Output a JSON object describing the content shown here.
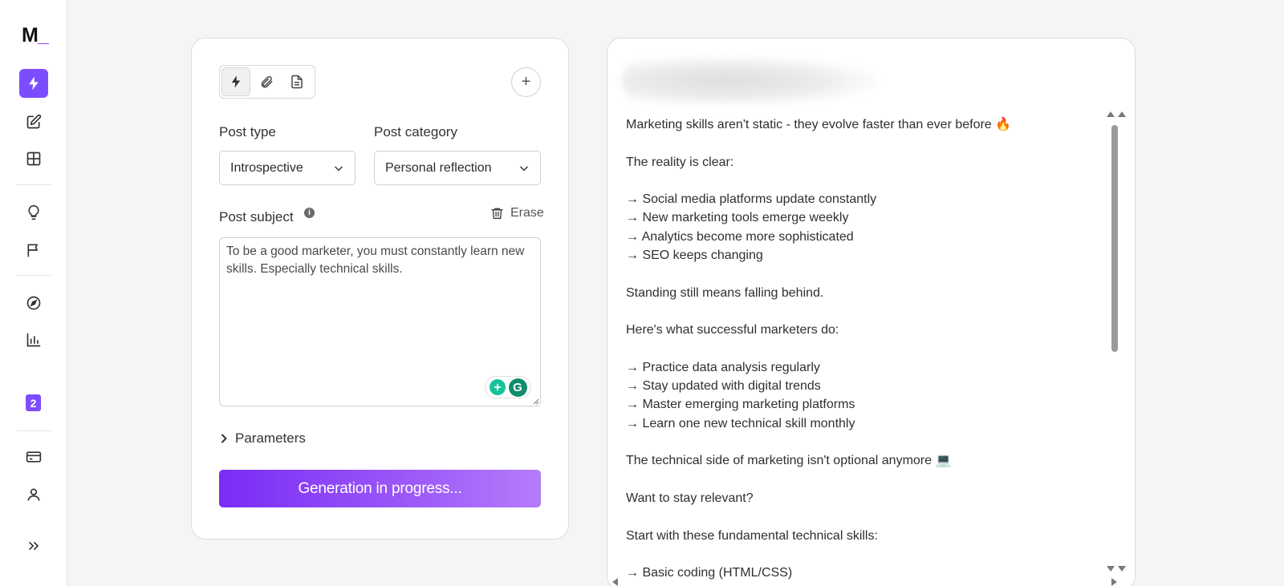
{
  "logo": {
    "text": "M",
    "accent": "_"
  },
  "colors": {
    "accent": "#7c4dff",
    "button_start": "#7a2cf5",
    "button_end": "#b47cfb"
  },
  "sidebar": {
    "icons": [
      "bolt-icon",
      "edit-icon",
      "grid-icon",
      "lightbulb-icon",
      "flag-icon",
      "compass-icon",
      "bar-chart-icon",
      "credit-card-icon",
      "user-icon",
      "double-chevron-right-icon"
    ],
    "badge": "2"
  },
  "form": {
    "modes": [
      "bolt-icon",
      "paperclip-icon",
      "document-icon"
    ],
    "add_label": "+",
    "post_type": {
      "label": "Post type",
      "value": "Introspective"
    },
    "post_category": {
      "label": "Post category",
      "value": "Personal reflection"
    },
    "post_subject": {
      "label": "Post subject",
      "info": "i",
      "erase_label": "Erase",
      "value": "To be a good marketer, you must constantly learn new skills. Especially technical skills."
    },
    "parameters_label": "Parameters",
    "generate_label": "Generation in progress..."
  },
  "result": {
    "lines": [
      "Marketing skills aren't static - they evolve faster than ever before 🔥",
      "",
      "The reality is clear:",
      "",
      "→ Social media platforms update constantly",
      "→ New marketing tools emerge weekly",
      "→ Analytics become more sophisticated",
      "→ SEO keeps changing",
      "",
      "Standing still means falling behind.",
      "",
      "Here's what successful marketers do:",
      "",
      "→ Practice data analysis regularly",
      "→ Stay updated with digital trends",
      "→ Master emerging marketing platforms",
      "→ Learn one new technical skill monthly",
      "",
      "The technical side of marketing isn't optional anymore 💻",
      "",
      "Want to stay relevant?",
      "",
      "Start with these fundamental technical skills:",
      "",
      "→ Basic coding (HTML/CSS)"
    ]
  }
}
